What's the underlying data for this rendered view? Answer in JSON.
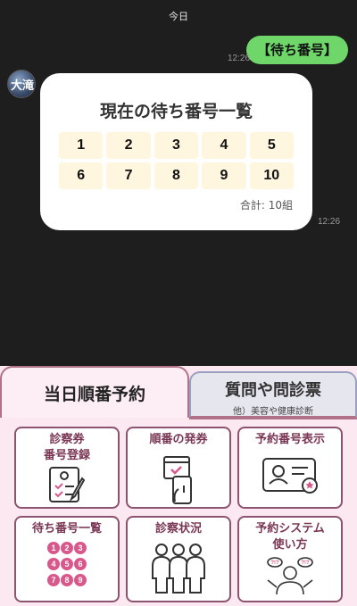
{
  "chat": {
    "date": "今日",
    "user_message": "【待ち番号】",
    "user_time": "12:26",
    "bot_time": "12:26",
    "avatar_text": "大滝"
  },
  "card": {
    "title": "現在の待ち番号一覧",
    "numbers": [
      "1",
      "2",
      "3",
      "4",
      "5",
      "6",
      "7",
      "8",
      "9",
      "10"
    ],
    "total": "合計: 10組"
  },
  "menu": {
    "tab_active": "当日順番予約",
    "tab_inactive_title": "質問や問診票",
    "tab_inactive_sub": "他）美容や健康診断",
    "tiles": {
      "register_line1": "診察券",
      "register_line2": "番号登録",
      "ticket": "順番の発券",
      "reserve_number": "予約番号表示",
      "waiting_list": "待ち番号一覧",
      "status": "診察状況",
      "howto_line1": "予約システム",
      "howto_line2": "使い方"
    }
  }
}
